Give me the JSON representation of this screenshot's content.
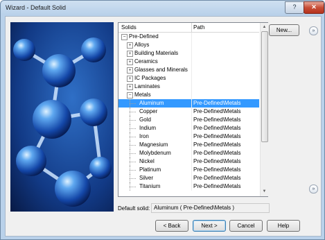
{
  "window": {
    "title": "Wizard - Default Solid",
    "help_glyph": "?",
    "close_glyph": "✕"
  },
  "table": {
    "columns": [
      "Solids",
      "Path"
    ],
    "rows": [
      {
        "name": "Pre-Defined",
        "path": "",
        "level": 0,
        "expander": "−",
        "selected": false
      },
      {
        "name": "Alloys",
        "path": "",
        "level": 1,
        "expander": "+",
        "selected": false
      },
      {
        "name": "Building Materials",
        "path": "",
        "level": 1,
        "expander": "+",
        "selected": false
      },
      {
        "name": "Ceramics",
        "path": "",
        "level": 1,
        "expander": "+",
        "selected": false
      },
      {
        "name": "Glasses and Minerals",
        "path": "",
        "level": 1,
        "expander": "+",
        "selected": false
      },
      {
        "name": "IC Packages",
        "path": "",
        "level": 1,
        "expander": "+",
        "selected": false
      },
      {
        "name": "Laminates",
        "path": "",
        "level": 1,
        "expander": "+",
        "selected": false
      },
      {
        "name": "Metals",
        "path": "",
        "level": 1,
        "expander": "−",
        "selected": false
      },
      {
        "name": "Aluminum",
        "path": "Pre-Defined\\Metals",
        "level": 2,
        "expander": "",
        "selected": true
      },
      {
        "name": "Copper",
        "path": "Pre-Defined\\Metals",
        "level": 2,
        "expander": "",
        "selected": false
      },
      {
        "name": "Gold",
        "path": "Pre-Defined\\Metals",
        "level": 2,
        "expander": "",
        "selected": false
      },
      {
        "name": "Indium",
        "path": "Pre-Defined\\Metals",
        "level": 2,
        "expander": "",
        "selected": false
      },
      {
        "name": "Iron",
        "path": "Pre-Defined\\Metals",
        "level": 2,
        "expander": "",
        "selected": false
      },
      {
        "name": "Magnesium",
        "path": "Pre-Defined\\Metals",
        "level": 2,
        "expander": "",
        "selected": false
      },
      {
        "name": "Molybdenum",
        "path": "Pre-Defined\\Metals",
        "level": 2,
        "expander": "",
        "selected": false
      },
      {
        "name": "Nickel",
        "path": "Pre-Defined\\Metals",
        "level": 2,
        "expander": "",
        "selected": false
      },
      {
        "name": "Platinum",
        "path": "Pre-Defined\\Metals",
        "level": 2,
        "expander": "",
        "selected": false
      },
      {
        "name": "Silver",
        "path": "Pre-Defined\\Metals",
        "level": 2,
        "expander": "",
        "selected": false
      },
      {
        "name": "Titanium",
        "path": "Pre-Defined\\Metals",
        "level": 2,
        "expander": "",
        "selected": false
      }
    ]
  },
  "side": {
    "new_label": "New...",
    "chevron_glyph": "»"
  },
  "default_solid": {
    "label": "Default solid:",
    "value": "Aluminum ( Pre-Defined\\Metals )"
  },
  "buttons": {
    "back": "< Back",
    "next": "Next >",
    "cancel": "Cancel",
    "help": "Help"
  },
  "scroll": {
    "up_glyph": "▲",
    "down_glyph": "▼"
  },
  "colors": {
    "selection": "#3399ff",
    "hero_background": "#0a1d4c"
  }
}
